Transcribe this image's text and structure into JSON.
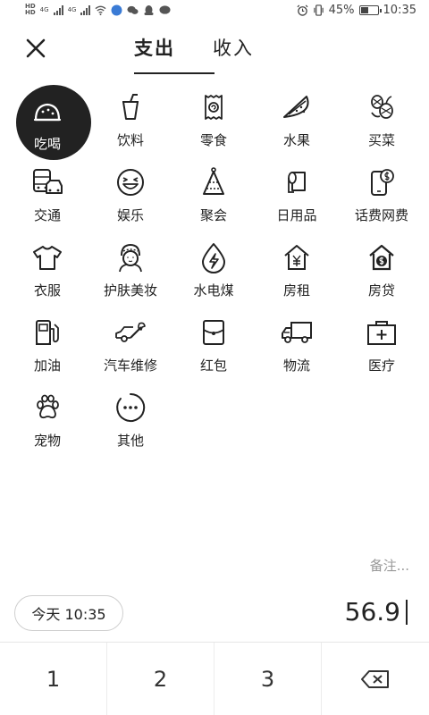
{
  "status_bar": {
    "hd_top": "HD",
    "hd_bottom": "HD",
    "net1": "4G",
    "net2": "4G",
    "battery": "45%",
    "battery_level": 0.45,
    "time": "10:35"
  },
  "header": {
    "tabs": [
      {
        "label": "支出",
        "active": true
      },
      {
        "label": "收入",
        "active": false
      }
    ]
  },
  "categories": [
    {
      "label": "吃喝",
      "icon": "food-icon",
      "selected": true
    },
    {
      "label": "饮料",
      "icon": "drink-icon"
    },
    {
      "label": "零食",
      "icon": "snack-icon"
    },
    {
      "label": "水果",
      "icon": "watermelon-icon"
    },
    {
      "label": "买菜",
      "icon": "groceries-icon"
    },
    {
      "label": "交通",
      "icon": "transport-icon"
    },
    {
      "label": "娱乐",
      "icon": "entertainment-icon"
    },
    {
      "label": "聚会",
      "icon": "party-hat-icon"
    },
    {
      "label": "日用品",
      "icon": "tissue-icon"
    },
    {
      "label": "话费网费",
      "icon": "phone-bill-icon"
    },
    {
      "label": "衣服",
      "icon": "tshirt-icon"
    },
    {
      "label": "护肤美妆",
      "icon": "skincare-icon"
    },
    {
      "label": "水电煤",
      "icon": "utilities-icon"
    },
    {
      "label": "房租",
      "icon": "rent-icon"
    },
    {
      "label": "房贷",
      "icon": "mortgage-icon"
    },
    {
      "label": "加油",
      "icon": "fuel-icon"
    },
    {
      "label": "汽车维修",
      "icon": "car-repair-icon"
    },
    {
      "label": "红包",
      "icon": "red-envelope-icon"
    },
    {
      "label": "物流",
      "icon": "truck-icon"
    },
    {
      "label": "医疗",
      "icon": "medical-kit-icon"
    },
    {
      "label": "宠物",
      "icon": "paw-icon"
    },
    {
      "label": "其他",
      "icon": "more-icon"
    }
  ],
  "note": {
    "placeholder": "备注..."
  },
  "date_button": {
    "label": "今天 10:35"
  },
  "amount": {
    "value": "56.9"
  },
  "keypad": {
    "keys": [
      "1",
      "2",
      "3"
    ]
  },
  "colors": {
    "accent": "#222222",
    "text_muted": "#999999",
    "border": "#cfcfcf"
  }
}
